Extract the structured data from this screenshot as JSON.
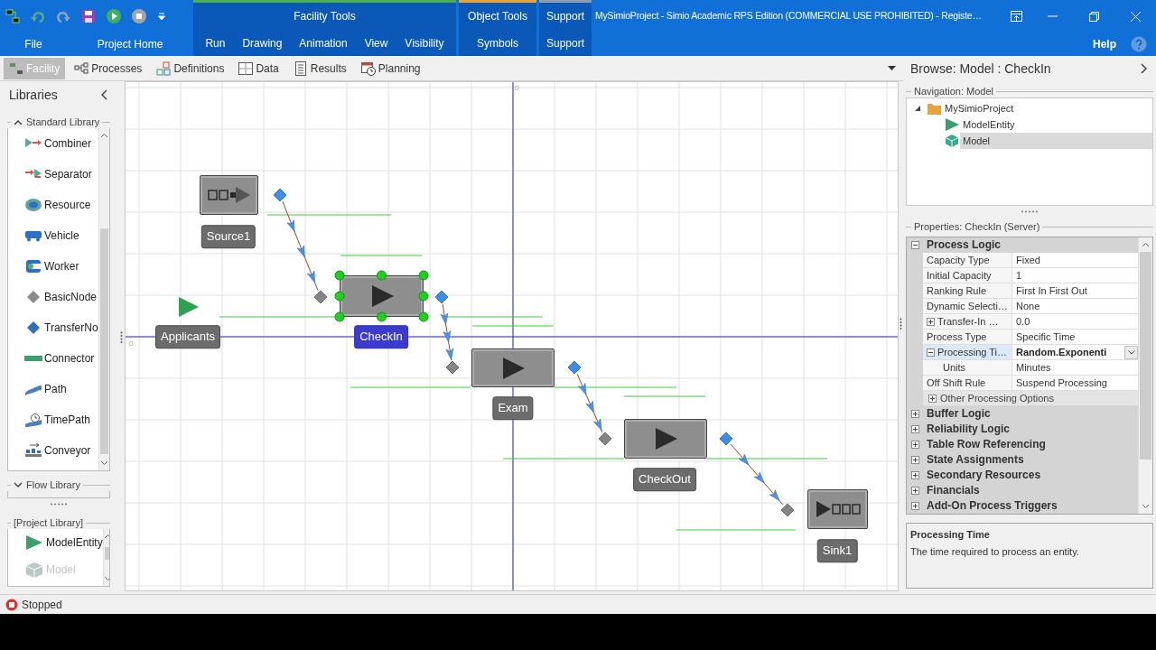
{
  "window": {
    "title": "MySimioProject - Simio Academic RPS Edition (COMMERCIAL USE PROHIBITED) - Registe…"
  },
  "ribbon": {
    "tabs": [
      {
        "label": "File",
        "selected": false
      },
      {
        "label": "Project Home",
        "selected": false
      }
    ],
    "context_groups": [
      {
        "title": "Facility Tools",
        "color": "#4caf50",
        "tabs": [
          {
            "label": "Run",
            "selected": false
          },
          {
            "label": "Drawing",
            "selected": false
          },
          {
            "label": "Animation",
            "selected": false
          },
          {
            "label": "View",
            "selected": false
          },
          {
            "label": "Visibility",
            "selected": false
          }
        ]
      },
      {
        "title": "Object Tools",
        "color": "#e8a33c",
        "tabs": [
          {
            "label": "Symbols",
            "selected": false
          }
        ]
      },
      {
        "title": "Support",
        "color": "#8d9bb3",
        "tabs": [
          {
            "label": "Support",
            "selected": false
          }
        ]
      }
    ],
    "help": "Help"
  },
  "view_tabs": [
    {
      "label": "Facility",
      "selected": true
    },
    {
      "label": "Processes",
      "selected": false
    },
    {
      "label": "Definitions",
      "selected": false
    },
    {
      "label": "Data",
      "selected": false
    },
    {
      "label": "Results",
      "selected": false
    },
    {
      "label": "Planning",
      "selected": false
    }
  ],
  "libraries": {
    "title": "Libraries",
    "standard_library": {
      "title": "Standard Library",
      "expanded": true,
      "items": [
        "Combiner",
        "Separator",
        "Resource",
        "Vehicle",
        "Worker",
        "BasicNode",
        "TransferNo",
        "Connector",
        "Path",
        "TimePath",
        "Conveyor"
      ]
    },
    "flow_library": {
      "title": "Flow Library",
      "expanded": false
    },
    "project_library": {
      "title": "[Project Library]",
      "items": [
        {
          "label": "ModelEntity",
          "disabled": false
        },
        {
          "label": "Model",
          "disabled": true
        }
      ]
    }
  },
  "canvas": {
    "axis_labels": [
      "0",
      "0"
    ],
    "objects": [
      {
        "kind": "source",
        "label": "Source1",
        "selected": false
      },
      {
        "kind": "entity",
        "label": "Applicants",
        "selected": false
      },
      {
        "kind": "server",
        "label": "CheckIn",
        "selected": true
      },
      {
        "kind": "server",
        "label": "Exam",
        "selected": false
      },
      {
        "kind": "server",
        "label": "CheckOut",
        "selected": false
      },
      {
        "kind": "sink",
        "label": "Sink1",
        "selected": false
      }
    ]
  },
  "browse": {
    "title": "Browse: Model : CheckIn"
  },
  "navigation": {
    "title": "Navigation: Model",
    "tree": [
      {
        "label": "MySimioProject",
        "expanded": true,
        "selected": false,
        "children": [
          {
            "label": "ModelEntity",
            "selected": false
          },
          {
            "label": "Model",
            "selected": true
          }
        ]
      }
    ]
  },
  "properties": {
    "title": "Properties: CheckIn (Server)",
    "categories": [
      {
        "label": "Process Logic",
        "expanded": true,
        "rows": [
          {
            "name": "Capacity Type",
            "value": "Fixed",
            "selected": false
          },
          {
            "name": "Initial Capacity",
            "value": "1",
            "selected": false
          },
          {
            "name": "Ranking Rule",
            "value": "First In First Out",
            "selected": false
          },
          {
            "name": "Dynamic Selecti…",
            "value": "None",
            "selected": false
          },
          {
            "name": "Transfer-In …",
            "value": "0.0",
            "expanded": false,
            "selected": false
          },
          {
            "name": "Process Type",
            "value": "Specific Time",
            "selected": false
          },
          {
            "name": "Processing Ti…",
            "value": "Random.Exponenti",
            "expanded": true,
            "selected": true,
            "children": [
              {
                "name": "Units",
                "value": "Minutes",
                "selected": false
              }
            ]
          },
          {
            "name": "Off Shift Rule",
            "value": "Suspend Processing",
            "selected": false
          },
          {
            "kind": "subgroup",
            "name": "Other Processing Options",
            "expanded": false
          }
        ]
      },
      {
        "label": "Buffer Logic",
        "expanded": false
      },
      {
        "label": "Reliability Logic",
        "expanded": false
      },
      {
        "label": "Table Row Referencing",
        "expanded": false
      },
      {
        "label": "State Assignments",
        "expanded": false
      },
      {
        "label": "Secondary Resources",
        "expanded": false
      },
      {
        "label": "Financials",
        "expanded": false
      },
      {
        "label": "Add-On Process Triggers",
        "expanded": false
      }
    ]
  },
  "description": {
    "title": "Processing Time",
    "text": "The time required to process an entity."
  },
  "status_bar": {
    "state": "Stopped"
  }
}
